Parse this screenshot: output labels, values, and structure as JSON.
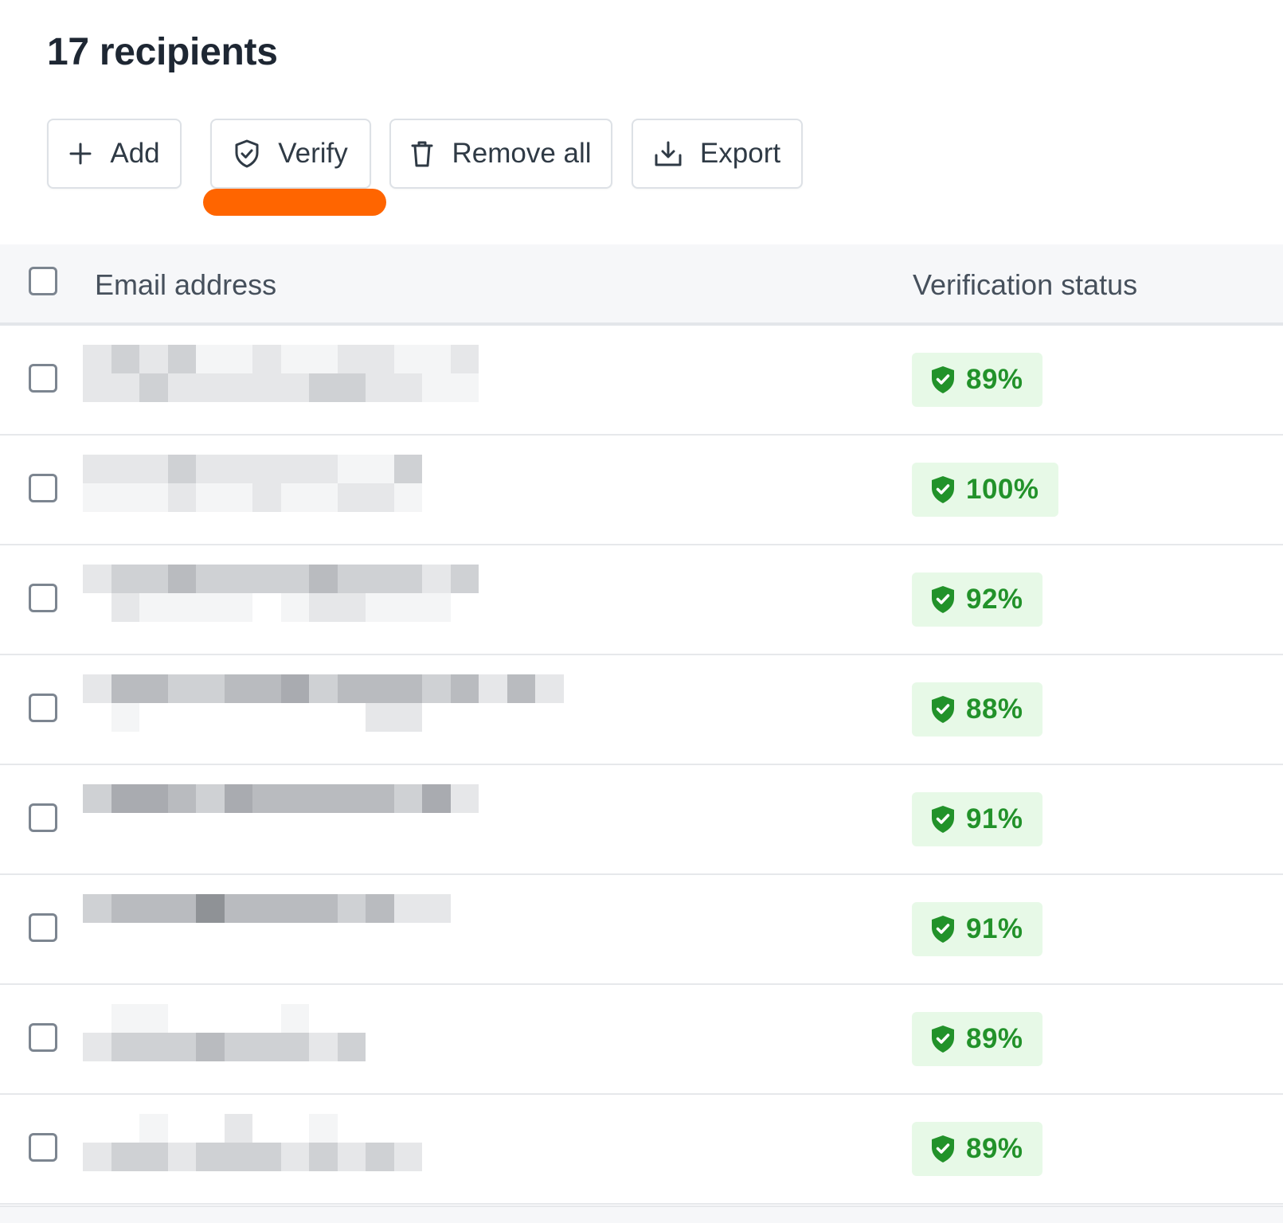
{
  "header": {
    "title": "17 recipients"
  },
  "toolbar": {
    "add_label": "Add",
    "verify_label": "Verify",
    "remove_all_label": "Remove all",
    "export_label": "Export",
    "icons": [
      "plus-icon",
      "shield-check-icon",
      "trash-icon",
      "download-icon"
    ]
  },
  "table": {
    "columns": [
      "Email address",
      "Verification status"
    ],
    "rows": [
      {
        "email_redacted": true,
        "status": "89%",
        "score": 89
      },
      {
        "email_redacted": true,
        "status": "100%",
        "score": 100
      },
      {
        "email_redacted": true,
        "status": "92%",
        "score": 92
      },
      {
        "email_redacted": true,
        "status": "88%",
        "score": 88
      },
      {
        "email_redacted": true,
        "status": "91%",
        "score": 91
      },
      {
        "email_redacted": true,
        "status": "91%",
        "score": 91
      },
      {
        "email_redacted": true,
        "status": "89%",
        "score": 89
      },
      {
        "email_redacted": true,
        "status": "89%",
        "score": 89
      }
    ]
  },
  "colors": {
    "focus_indicator": "#ff6500",
    "status_text": "#22922a",
    "status_bg": "#e7f9e7",
    "title": "#1e2733"
  }
}
